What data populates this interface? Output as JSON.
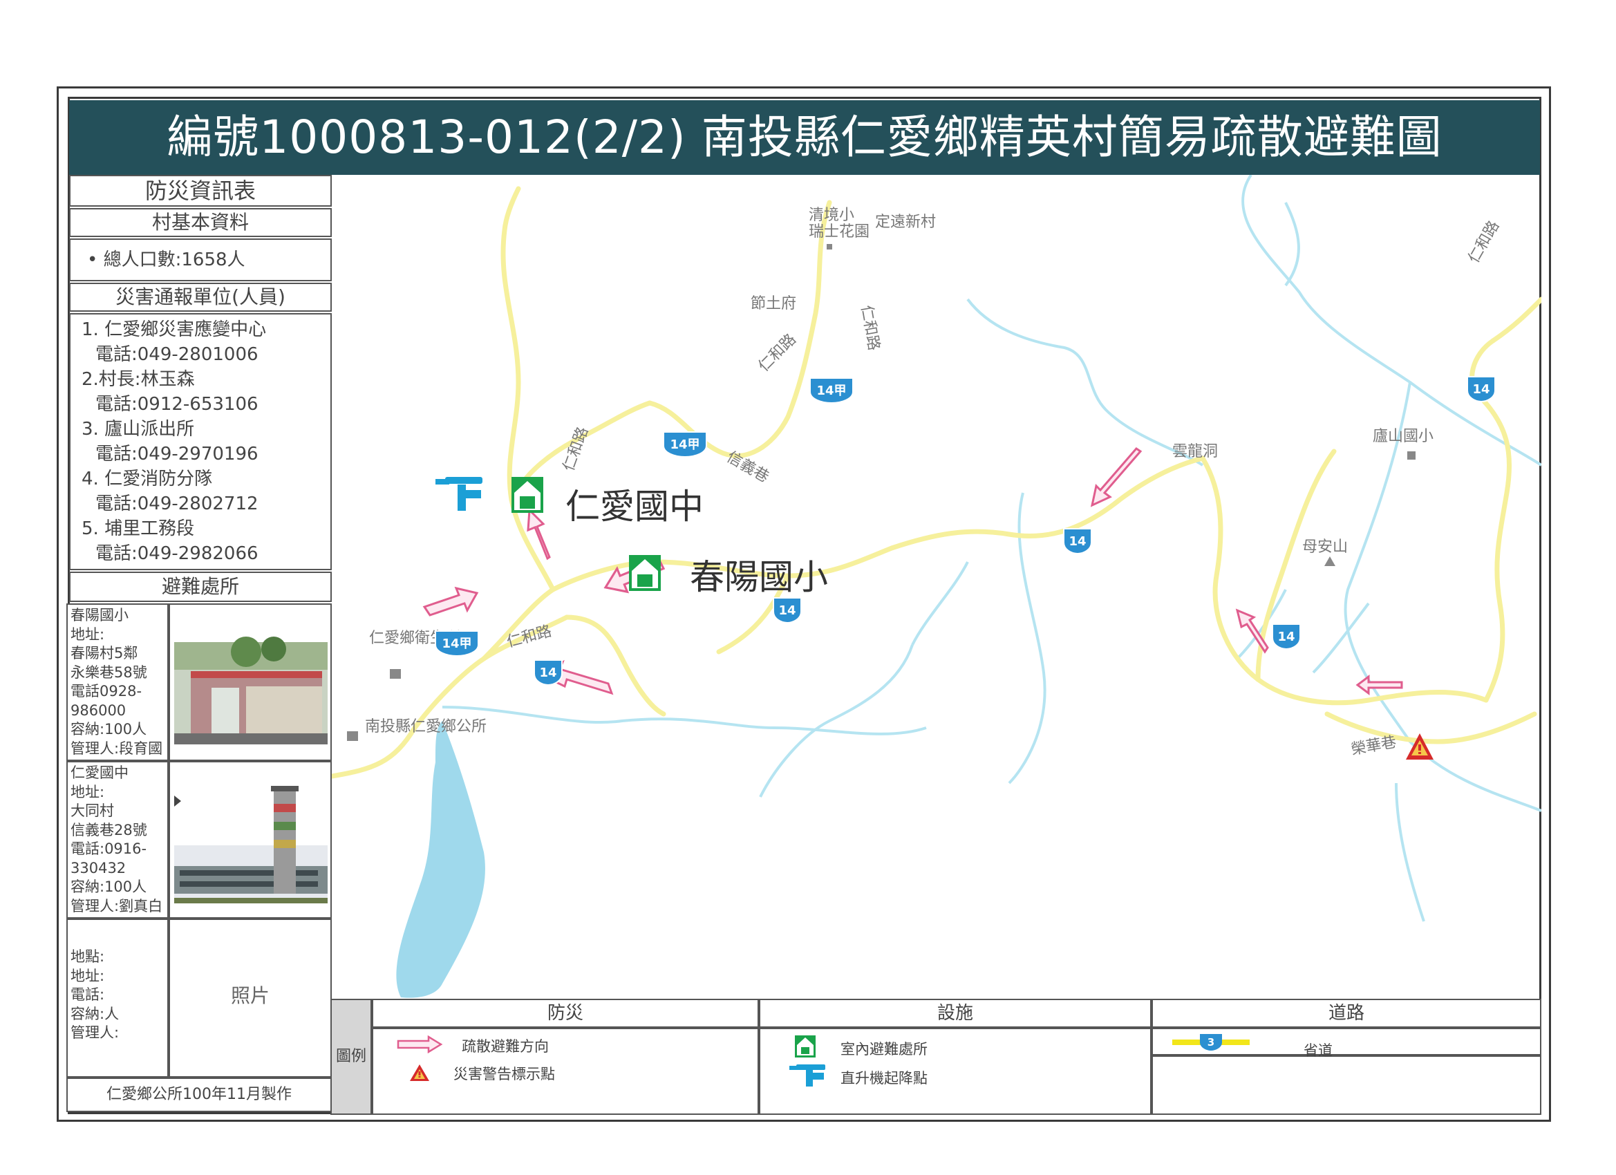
{
  "title": "編號1000813-012(2/2)  南投縣仁愛鄉精英村簡易疏散避難圖",
  "info_panel": {
    "heading": "防災資訊表",
    "village_basic_header": "村基本資料",
    "population": "• 總人口數:1658人",
    "report_units_header": "災害通報單位(人員)",
    "report_units": [
      {
        "name": "1. 仁愛鄉災害應變中心",
        "phone": "電話:049-2801006"
      },
      {
        "name": "2.村長:林玉森",
        "phone": "電話:0912-653106"
      },
      {
        "name": "3. 廬山派出所",
        "phone": "電話:049-2970196"
      },
      {
        "name": "4. 仁愛消防分隊",
        "phone": "電話:049-2802712"
      },
      {
        "name": "5. 埔里工務段",
        "phone": "電話:049-2982066"
      }
    ],
    "shelters_header": "避難處所",
    "shelters": [
      {
        "lines": [
          "春陽國小",
          "地址:",
          "春陽村5鄰",
          "永樂巷58號",
          "電話0928-",
          "986000",
          "容納:100人",
          "管理人:段育國"
        ]
      },
      {
        "lines": [
          "仁愛國中",
          "地址:",
          "大同村",
          "信義巷28號",
          "電話:0916-",
          "330432",
          "容納:100人",
          "管理人:劉真白"
        ]
      },
      {
        "lines": [
          "地點:",
          "地址:",
          "電話:",
          "容納:人",
          "管理人:"
        ]
      }
    ],
    "photo_placeholder": "照片",
    "footer": "仁愛鄉公所100年11月製作"
  },
  "map": {
    "places": [
      {
        "name": "清境小"
      },
      {
        "name": "瑞士花園"
      },
      {
        "name": "定遠新村"
      },
      {
        "name": "節土府"
      },
      {
        "name": "仁和路"
      },
      {
        "name": "仁和路"
      },
      {
        "name": "仁和路"
      },
      {
        "name": "仁和路"
      },
      {
        "name": "信義巷"
      },
      {
        "name": "雲龍洞"
      },
      {
        "name": "廬山國小"
      },
      {
        "name": "母安山"
      },
      {
        "name": "仁愛鄉衛生所"
      },
      {
        "name": "南投縣仁愛鄉公所"
      },
      {
        "name": "榮華巷"
      },
      {
        "name": "仁和路"
      }
    ],
    "shelters": [
      {
        "name": "仁愛國中"
      },
      {
        "name": "春陽國小"
      }
    ],
    "route_shields": [
      "14甲",
      "14甲",
      "14甲",
      "14",
      "14",
      "14",
      "14",
      "14"
    ],
    "colors": {
      "road": "#f5ef9a",
      "river": "#a9e2ef",
      "lake": "#8fd3ea",
      "arrow": "#e05d8e",
      "shelter": "#1aa34a",
      "heli": "#1b9fd6",
      "shield": "#2b8fd1"
    }
  },
  "legend": {
    "label": "圖例",
    "disaster_header": "防災",
    "facility_header": "設施",
    "road_header": "道路",
    "evac_direction": "疏散避難方向",
    "warning_point": "災害警告標示點",
    "indoor_shelter": "室內避難處所",
    "helipad": "直升機起降點",
    "provincial_road": "省道",
    "road_shield_number": "3"
  }
}
